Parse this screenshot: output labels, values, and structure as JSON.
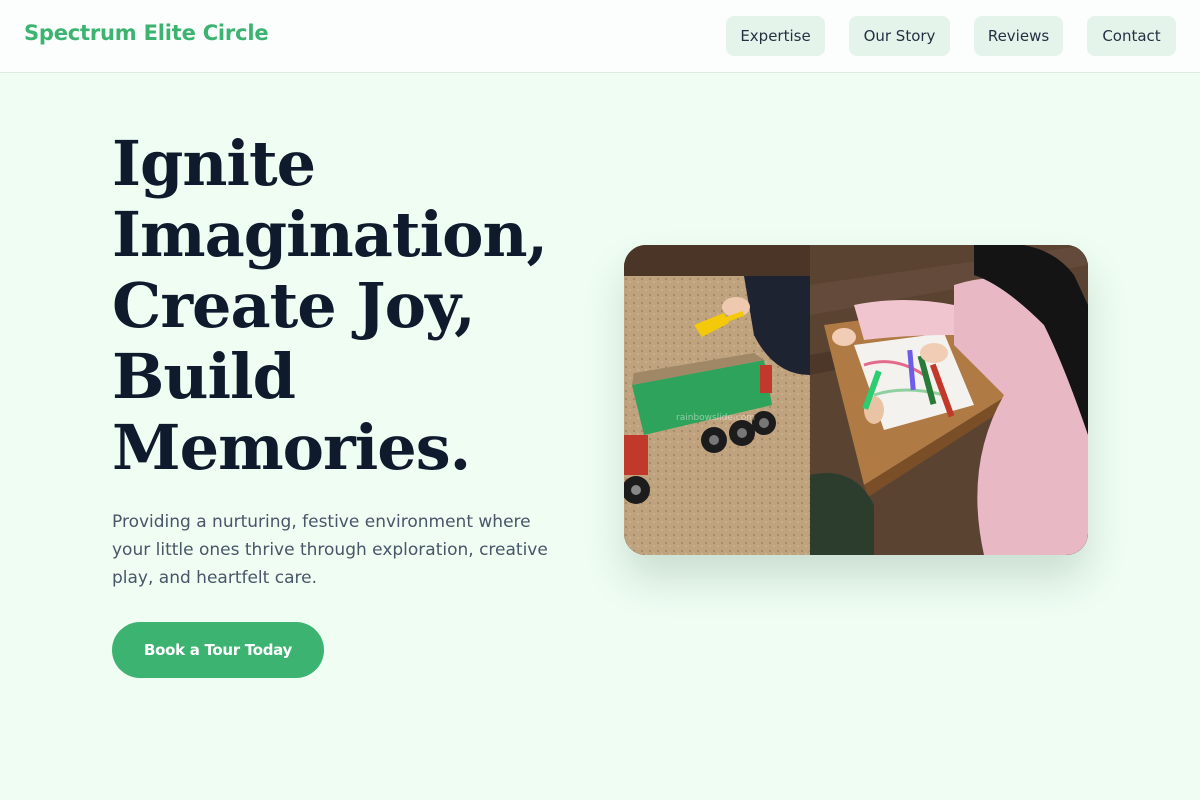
{
  "brand": {
    "name": "Spectrum Elite Circle"
  },
  "nav": {
    "items": [
      {
        "label": "Expertise"
      },
      {
        "label": "Our Story"
      },
      {
        "label": "Reviews"
      },
      {
        "label": "Contact"
      }
    ]
  },
  "hero": {
    "headline_lines": [
      "Ignite",
      "Imagination,",
      "Create Joy,",
      "Build",
      "Memories."
    ],
    "subtext": "Providing a nurturing, festive environment where your little ones thrive through exploration, creative play, and heartfelt care.",
    "cta_label": "Book a Tour Today",
    "image": {
      "subject": "children playing with toy truck in sand and drawing with markers at a table",
      "watermark": "rainbowslide.com"
    }
  },
  "colors": {
    "accent": "#3cb371",
    "page_bg": "#effdf3",
    "header_bg": "#fbfefc",
    "nav_btn_bg": "#e4f4ea",
    "headline": "#0f1b2d",
    "body_text": "#4a5568"
  }
}
